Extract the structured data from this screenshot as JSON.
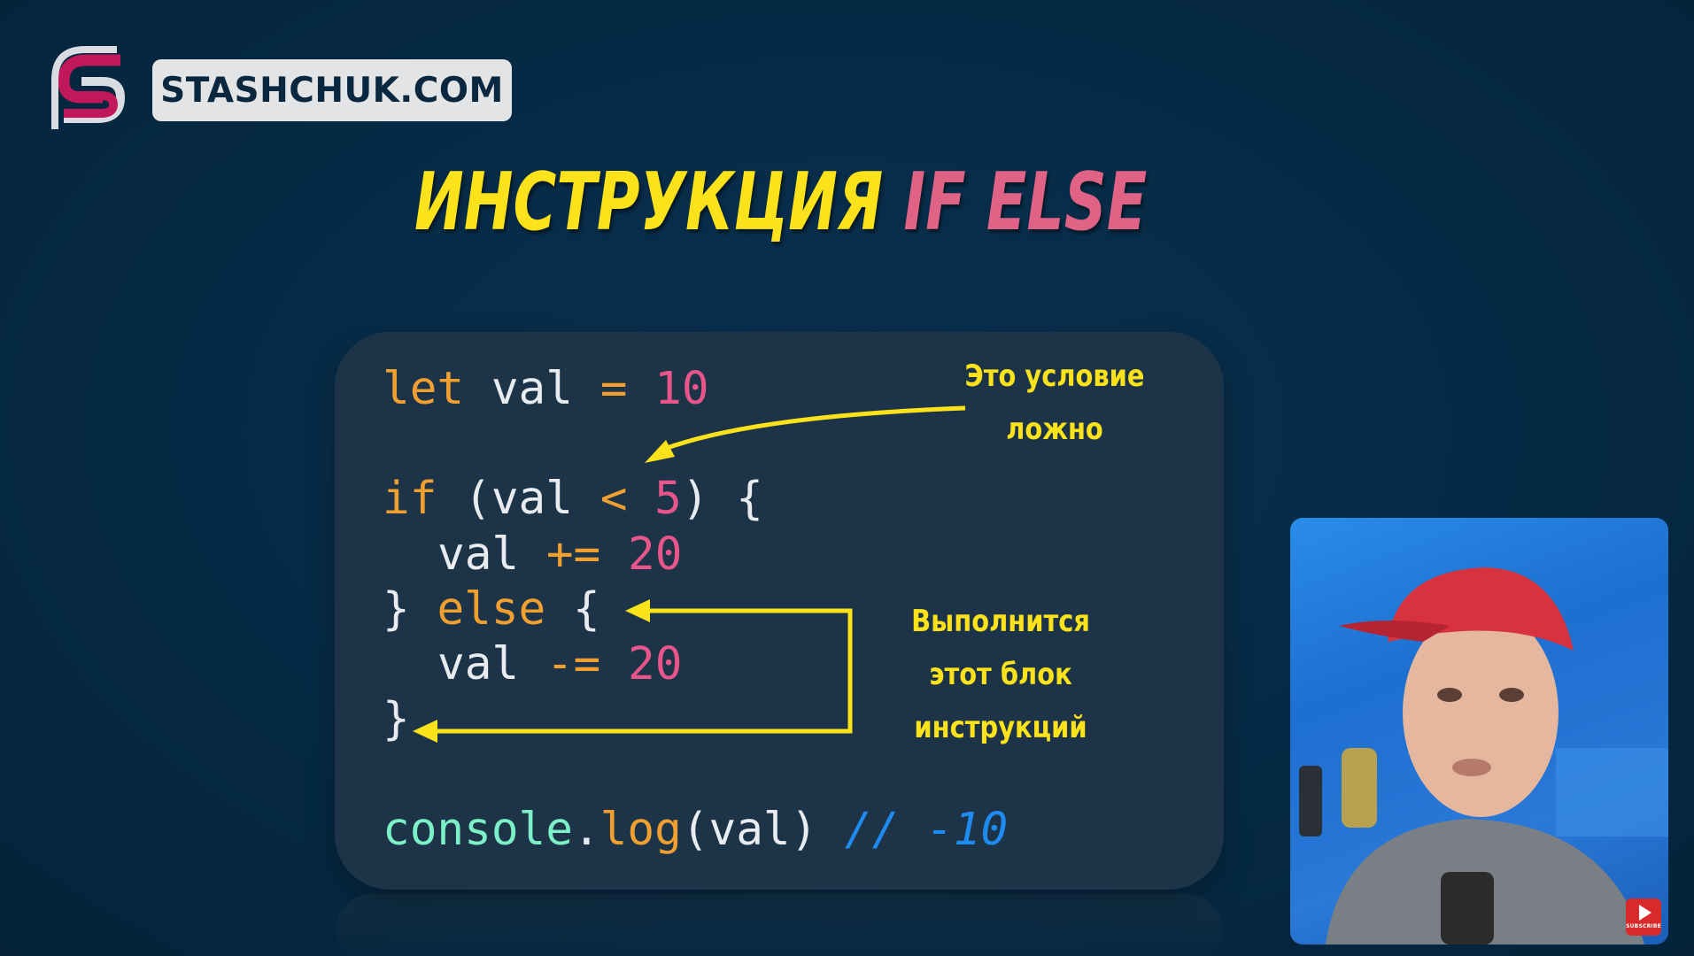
{
  "brand": {
    "site": "STASHCHUK.COM",
    "logo_icon": "stashchuk-s-logo",
    "colors": {
      "logo_primary": "#c1185b",
      "logo_secondary": "#d9dde2"
    }
  },
  "title": {
    "part1": "ИНСТРУКЦИЯ",
    "part2": "IF ELSE",
    "colors": {
      "part1": "#fbe21a",
      "part2": "#e06386"
    }
  },
  "code": {
    "line1": {
      "kw": "let",
      "id": "val",
      "op": "=",
      "num": "10"
    },
    "line2": {
      "kw": "if",
      "open": "(val",
      "op": "<",
      "num": "5",
      "close": ") {"
    },
    "line3": {
      "id": "val",
      "op": "+=",
      "num": "20"
    },
    "line4": {
      "open": "}",
      "kw": "else",
      "close": "{"
    },
    "line5": {
      "id": "val",
      "op": "-=",
      "num": "20"
    },
    "line6": {
      "close": "}"
    },
    "line7": {
      "obj": "console",
      "dot": ".",
      "fn": "log",
      "args": "(val)",
      "comment": "// -10"
    },
    "colors": {
      "keyword": "#f0a030",
      "number": "#e7558a",
      "identifier": "#e8ecf0",
      "object": "#7cf0c6",
      "comment": "#1f8bf0",
      "panel": "#1d3448"
    }
  },
  "annotations": {
    "condition": {
      "line1": "Это условие",
      "line2": "ложно"
    },
    "executes": {
      "line1": "Выполнится",
      "line2": "этот блок",
      "line3": "инструкций"
    },
    "arrow_color": "#fbe21a"
  },
  "webcam": {
    "subscribe_label": "SUBSCRIBE",
    "subscribe_icon": "youtube-play-icon"
  }
}
